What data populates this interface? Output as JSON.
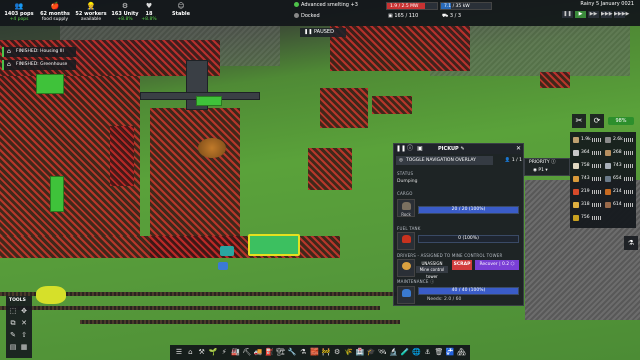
{
  "top_stats": [
    {
      "icon": "people-icon",
      "glyph": "👥",
      "value": "1403 pops",
      "sub": "+4 pops",
      "sub_color": "green"
    },
    {
      "icon": "food-icon",
      "glyph": "🍎",
      "value": "62 months",
      "sub": "food supply",
      "sub_color": "white"
    },
    {
      "icon": "workers-icon",
      "glyph": "👷",
      "value": "52 workers",
      "sub": "available",
      "sub_color": "white"
    },
    {
      "icon": "unity-icon",
      "glyph": "⚙",
      "value": "163 Unity",
      "sub": "+8.8%",
      "sub_color": "green"
    },
    {
      "icon": "health-icon",
      "glyph": "♥",
      "value": "18",
      "sub": "+8.8%",
      "sub_color": "green"
    },
    {
      "icon": "stable-icon",
      "glyph": "☺",
      "value": "Stable",
      "sub": "",
      "sub_color": "white"
    }
  ],
  "status": {
    "smelting": "Advanced smelting +3",
    "power_bar": "1.9 / 2.5 MW",
    "power_fill": 0.76,
    "water_bar": "7.1 / 35 kW",
    "water_fill": 0.2,
    "docked": "Docked",
    "storage": "165 / 110",
    "trucks": "3 / 3"
  },
  "datetime": "Rainy   5 January 0021",
  "speed_buttons": [
    "❚❚",
    "▶",
    "▶▶",
    "▶▶▶",
    "▶▶▶▶"
  ],
  "speed_active": 1,
  "paused_label": "PAUSED",
  "notifications": [
    {
      "icon": "house-icon",
      "text": "FINISHED: Housing III"
    },
    {
      "icon": "greenhouse-icon",
      "text": "FINISHED: Greenhouse"
    }
  ],
  "right_tools": {
    "pct": "98%"
  },
  "resources": [
    {
      "value": "1.9k",
      "color": "#bfa070"
    },
    {
      "value": "2.6k",
      "color": "#8a8a8a"
    },
    {
      "value": "364",
      "color": "#c8c8c8"
    },
    {
      "value": "268",
      "color": "#b89060"
    },
    {
      "value": "758",
      "color": "#e0d8c0"
    },
    {
      "value": "743",
      "color": "#a8b0b8"
    },
    {
      "value": "743",
      "color": "#d89a3a"
    },
    {
      "value": "654",
      "color": "#6a7a88"
    },
    {
      "value": "219",
      "color": "#d84a2a"
    },
    {
      "value": "214",
      "color": "#c86a20"
    },
    {
      "value": "318",
      "color": "#e0b040"
    },
    {
      "value": "614",
      "color": "#9a6a4a"
    },
    {
      "value": "756",
      "color": "#c8a020"
    },
    {
      "value": "",
      "color": ""
    }
  ],
  "panel": {
    "title": "PICKUP",
    "toggle_label": "TOGGLE NAVIGATION OVERLAY",
    "count": "1 / 1",
    "status_label": "STATUS",
    "status_value": "Dumping",
    "cargo_label": "CARGO",
    "cargo_item": "Rock",
    "cargo_bar": "20 / 20 (100%)",
    "cargo_fill": 1.0,
    "fuel_label": "FUEL TANK",
    "fuel_bar": "0 (100%)",
    "fuel_fill": 0.0,
    "drivers_label": "DRIVERS - ASSIGNED TO MINE CONTROL TOWER",
    "driver_name": "UNASSIGN",
    "driver_role": "Mine control tower",
    "scrap_label": "SCRAP",
    "recover_label": "Recover  |  0.2 ⬡",
    "maintenance_label": "MAINTENANCE",
    "maint_bar": "40 / 40 (100%)",
    "maint_fill": 1.0,
    "maint_needs": "Needs: 2.0 / 60"
  },
  "priority": {
    "label": "PRIORITY ⓘ",
    "value": "P1"
  },
  "tools": {
    "title": "TOOLS"
  },
  "bottom_icons": [
    "☰",
    "⌂",
    "⚒",
    "🌱",
    "⚡",
    "🏭",
    "⛏",
    "🚚",
    "⛽",
    "🏗",
    "🔧",
    "⚗",
    "🧱",
    "🚧",
    "⚙",
    "🌾",
    "🏥",
    "🎓",
    "🛰",
    "🔬",
    "🧪",
    "🌐",
    "⚓",
    "🗑",
    "🚰",
    "🏘"
  ]
}
